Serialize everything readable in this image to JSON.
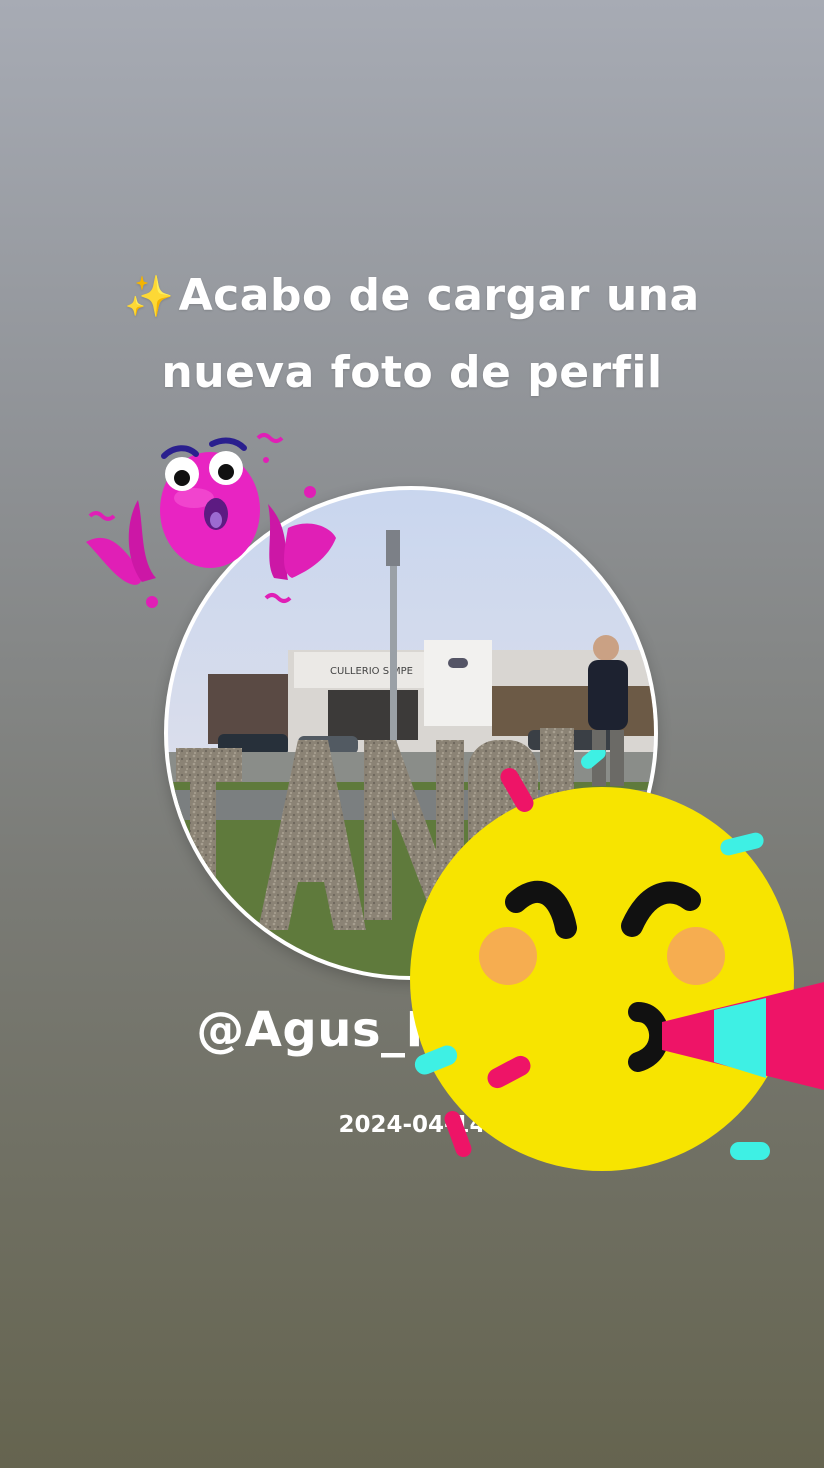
{
  "story": {
    "sparkle_icon": "✨",
    "headline": "Acabo de cargar una nueva foto de perfil",
    "username": "@Agus_Perez21",
    "date": "2024-04-14"
  },
  "photo": {
    "dealership_sign": "CULLERIO SIMPE"
  },
  "stickers": [
    {
      "name": "wow-sticker",
      "icon": "wow-octopus",
      "color": "#e01fb6"
    },
    {
      "name": "party-sticker",
      "icon": "party-horn-face",
      "color": "#f7e400"
    }
  ],
  "colors": {
    "text": "#ffffff",
    "bg_top": "#a7abb4",
    "bg_bottom": "#65644f"
  }
}
